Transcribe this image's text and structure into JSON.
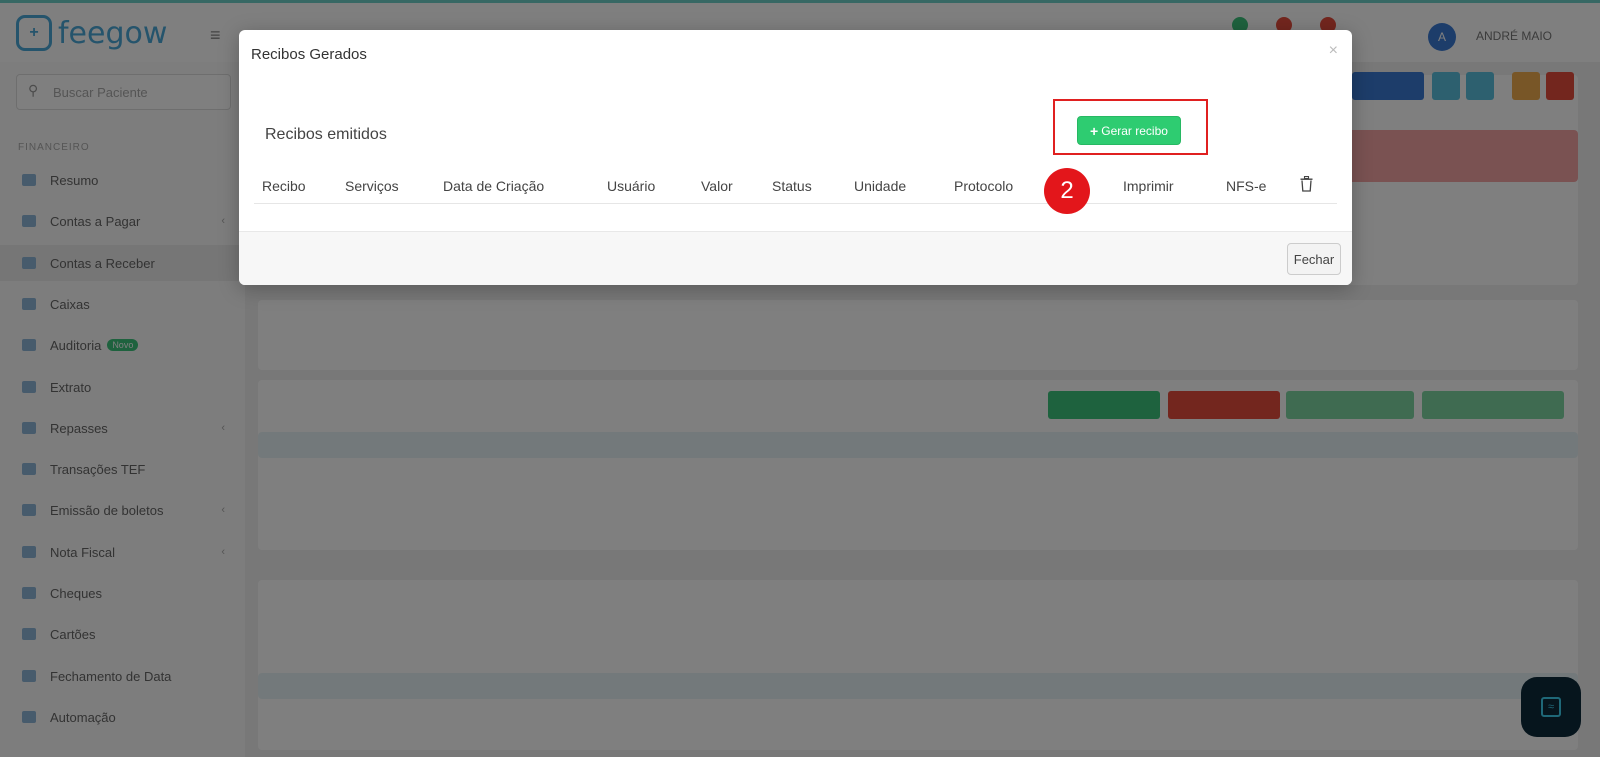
{
  "app": {
    "logo_text": "feegow",
    "logo_mark": "+",
    "menu_icon": "≡",
    "user_initial": "A",
    "user_name": "ANDRÉ MAIO",
    "search_placeholder": "Buscar Paciente",
    "section_label": "FINANCEIRO",
    "sidebar_items": [
      {
        "label": "Resumo"
      },
      {
        "label": "Contas a Pagar",
        "caret": "‹"
      },
      {
        "label": "Contas a Receber",
        "active": true
      },
      {
        "label": "Caixas"
      },
      {
        "label": "Auditoria",
        "badge": "Novo"
      },
      {
        "label": "Extrato"
      },
      {
        "label": "Repasses",
        "caret": "‹"
      },
      {
        "label": "Transações TEF"
      },
      {
        "label": "Emissão de boletos",
        "caret": "‹"
      },
      {
        "label": "Nota Fiscal",
        "caret": "‹"
      },
      {
        "label": "Cheques"
      },
      {
        "label": "Cartões"
      },
      {
        "label": "Fechamento de Data"
      },
      {
        "label": "Automação"
      }
    ]
  },
  "modal": {
    "title": "Recibos Gerados",
    "close_label": "×",
    "section_title": "Recibos emitidos",
    "gerar_plus": "+",
    "gerar_label": "Gerar recibo",
    "columns": [
      "Recibo",
      "Serviços",
      "Data de Criação",
      "Usuário",
      "Valor",
      "Status",
      "Unidade",
      "Protocolo",
      "Imprimir",
      "NFS-e"
    ],
    "step_number": "2",
    "fechar_label": "Fechar"
  },
  "colors": {
    "gerar_button": "#2ecc71",
    "highlight_box": "#e02020",
    "step_badge": "#e3161b"
  }
}
